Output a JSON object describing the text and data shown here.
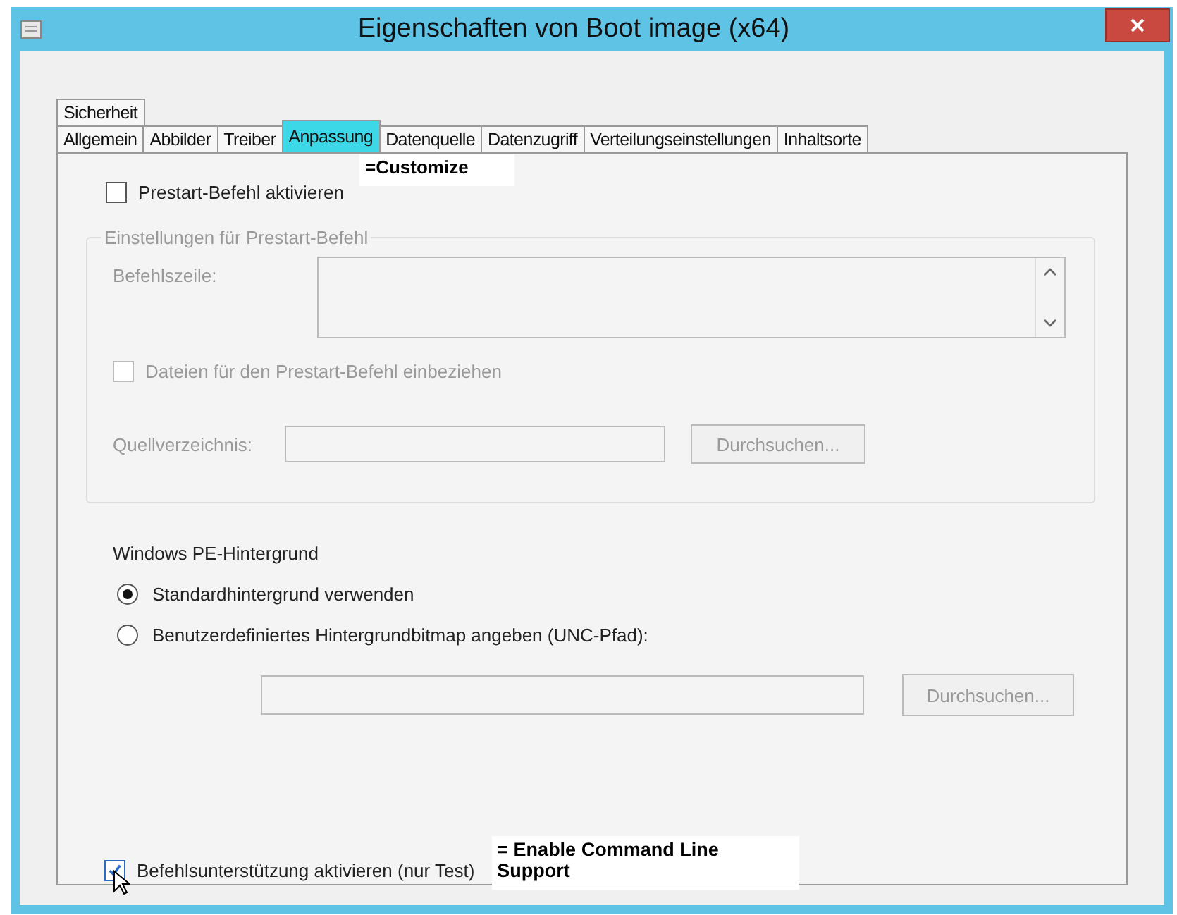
{
  "window": {
    "title": "Eigenschaften von Boot image (x64)"
  },
  "tab_rows": [
    {
      "tabs": [
        {
          "label": "Sicherheit",
          "selected": false
        }
      ]
    },
    {
      "tabs": [
        {
          "label": "Allgemein",
          "selected": false
        },
        {
          "label": "Abbilder",
          "selected": false
        },
        {
          "label": "Treiber",
          "selected": false
        },
        {
          "label": "Anpassung",
          "selected": true
        },
        {
          "label": "Datenquelle",
          "selected": false
        },
        {
          "label": "Datenzugriff",
          "selected": false
        },
        {
          "label": "Verteilungseinstellungen",
          "selected": false
        },
        {
          "label": "Inhaltsorte",
          "selected": false
        }
      ]
    }
  ],
  "customize_note": "=Customize",
  "prestart": {
    "label": "Prestart-Befehl aktivieren",
    "checked": false
  },
  "prestart_settings": {
    "legend": "Einstellungen für Prestart-Befehl",
    "disabled": true,
    "command_line_label": "Befehlszeile:",
    "include_files": {
      "label": "Dateien für den Prestart-Befehl einbeziehen",
      "checked": false
    },
    "source_folder_label": "Quellverzeichnis:",
    "browse_button": "Durchsuchen..."
  },
  "background": {
    "heading": "Windows PE-Hintergrund",
    "options": [
      {
        "label": "Standardhintergrund verwenden",
        "selected": true
      },
      {
        "label": "Benutzerdefiniertes Hintergrundbitmap angeben (UNC-Pfad):",
        "selected": false
      }
    ],
    "disabled": true,
    "browse_button": "Durchsuchen..."
  },
  "command_support": {
    "label": "Befehlsunterstützung aktivieren (nur Test)",
    "checked": true
  },
  "command_support_note": "= Enable Command Line Support"
}
